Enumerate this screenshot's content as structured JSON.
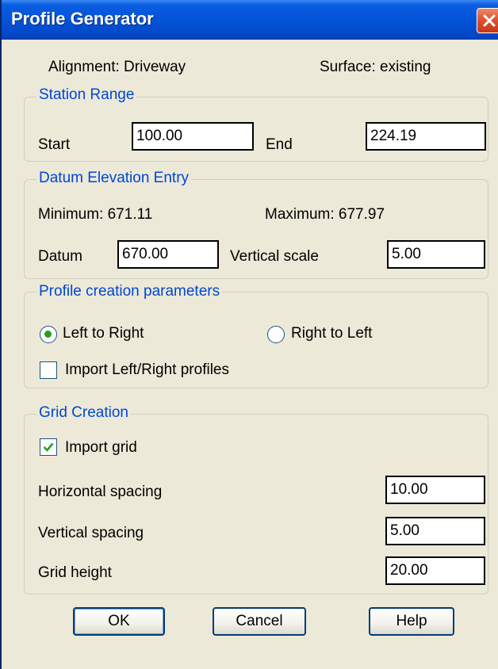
{
  "window": {
    "title": "Profile Generator"
  },
  "info": {
    "alignment": "Alignment: Driveway",
    "surface": "Surface: existing"
  },
  "station_range": {
    "legend": "Station Range",
    "start_label": "Start",
    "start_value": "100.00",
    "end_label": "End",
    "end_value": "224.19"
  },
  "datum": {
    "legend": "Datum Elevation Entry",
    "minimum": "Minimum: 671.11",
    "maximum": "Maximum: 677.97",
    "datum_label": "Datum",
    "datum_value": "670.00",
    "vscale_label": "Vertical scale",
    "vscale_value": "5.00"
  },
  "profile": {
    "legend": "Profile creation parameters",
    "left_to_right": "Left to Right",
    "right_to_left": "Right to Left",
    "selected": "Left to Right",
    "import_lr": "Import Left/Right profiles",
    "import_lr_checked": false
  },
  "grid": {
    "legend": "Grid Creation",
    "import_grid": "Import grid",
    "import_grid_checked": true,
    "hspacing_label": "Horizontal spacing",
    "hspacing_value": "10.00",
    "vspacing_label": "Vertical spacing",
    "vspacing_value": "5.00",
    "height_label": "Grid height",
    "height_value": "20.00"
  },
  "buttons": {
    "ok": "OK",
    "cancel": "Cancel",
    "help": "Help"
  },
  "colors": {
    "titlebar": "#0453d8",
    "group_legend": "#0046d5",
    "dialog_bg": "#ece9d8",
    "check_mark": "#21a121",
    "close_button": "#e0532d"
  }
}
